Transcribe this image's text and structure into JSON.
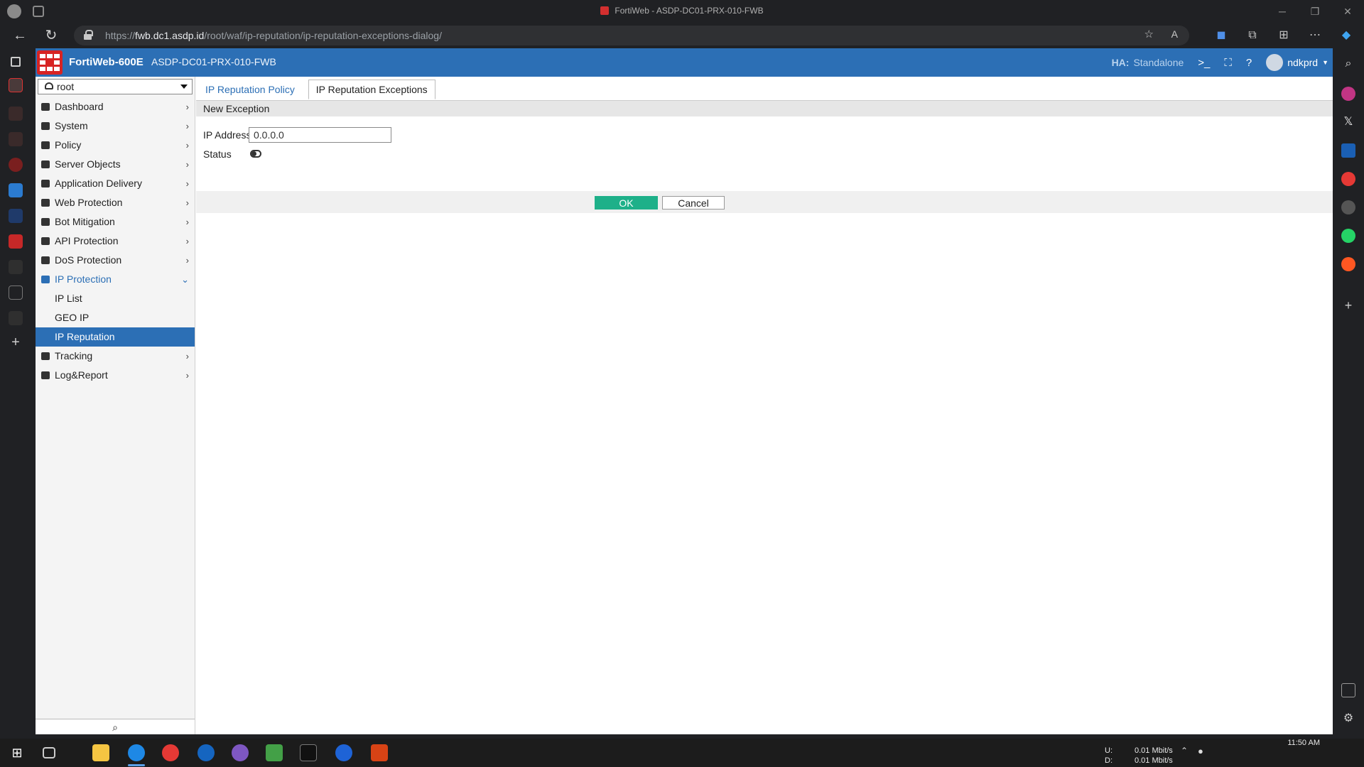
{
  "browser": {
    "window_title": "FortiWeb - ASDP-DC01-PRX-010-FWB",
    "url_prefix": "https://",
    "url_host": "fwb.dc1.asdp.id",
    "url_path": "/root/waf/ip-reputation/ip-reputation-exceptions-dialog/"
  },
  "header": {
    "product": "FortiWeb-600E",
    "hostname": "ASDP-DC01-PRX-010-FWB",
    "ha_label": "HA:",
    "ha_value": "Standalone",
    "user": "ndkprd"
  },
  "sidebar": {
    "vdom": "root",
    "items": [
      {
        "label": "Dashboard",
        "icon": "dashboard-icon"
      },
      {
        "label": "System",
        "icon": "gear-icon"
      },
      {
        "label": "Policy",
        "icon": "policy-icon"
      },
      {
        "label": "Server Objects",
        "icon": "server-icon"
      },
      {
        "label": "Application Delivery",
        "icon": "delivery-icon"
      },
      {
        "label": "Web Protection",
        "icon": "lock-icon"
      },
      {
        "label": "Bot Mitigation",
        "icon": "bot-icon"
      },
      {
        "label": "API Protection",
        "icon": "api-icon"
      },
      {
        "label": "DoS Protection",
        "icon": "shield-icon"
      },
      {
        "label": "IP Protection",
        "icon": "ip-protection-icon"
      },
      {
        "label": "Tracking",
        "icon": "monitor-icon"
      },
      {
        "label": "Log&Report",
        "icon": "chart-icon"
      }
    ],
    "submenu": [
      {
        "label": "IP List"
      },
      {
        "label": "GEO IP"
      },
      {
        "label": "IP Reputation"
      }
    ]
  },
  "main": {
    "tabs": [
      {
        "label": "IP Reputation Policy"
      },
      {
        "label": "IP Reputation Exceptions"
      }
    ],
    "section_title": "New Exception",
    "form": {
      "ip_label": "IP Address",
      "ip_value": "0.0.0.0",
      "status_label": "Status",
      "status_enabled": false
    },
    "ok_label": "OK",
    "cancel_label": "Cancel"
  },
  "taskbar": {
    "upload_label": "U:",
    "download_label": "D:",
    "upload_value": "0.01 Mbit/s",
    "download_value": "0.01 Mbit/s",
    "time": "11:50 AM"
  },
  "colors": {
    "brand_blue": "#2c6fb5",
    "logo_red": "#d72323",
    "ok_green": "#1eb089"
  }
}
